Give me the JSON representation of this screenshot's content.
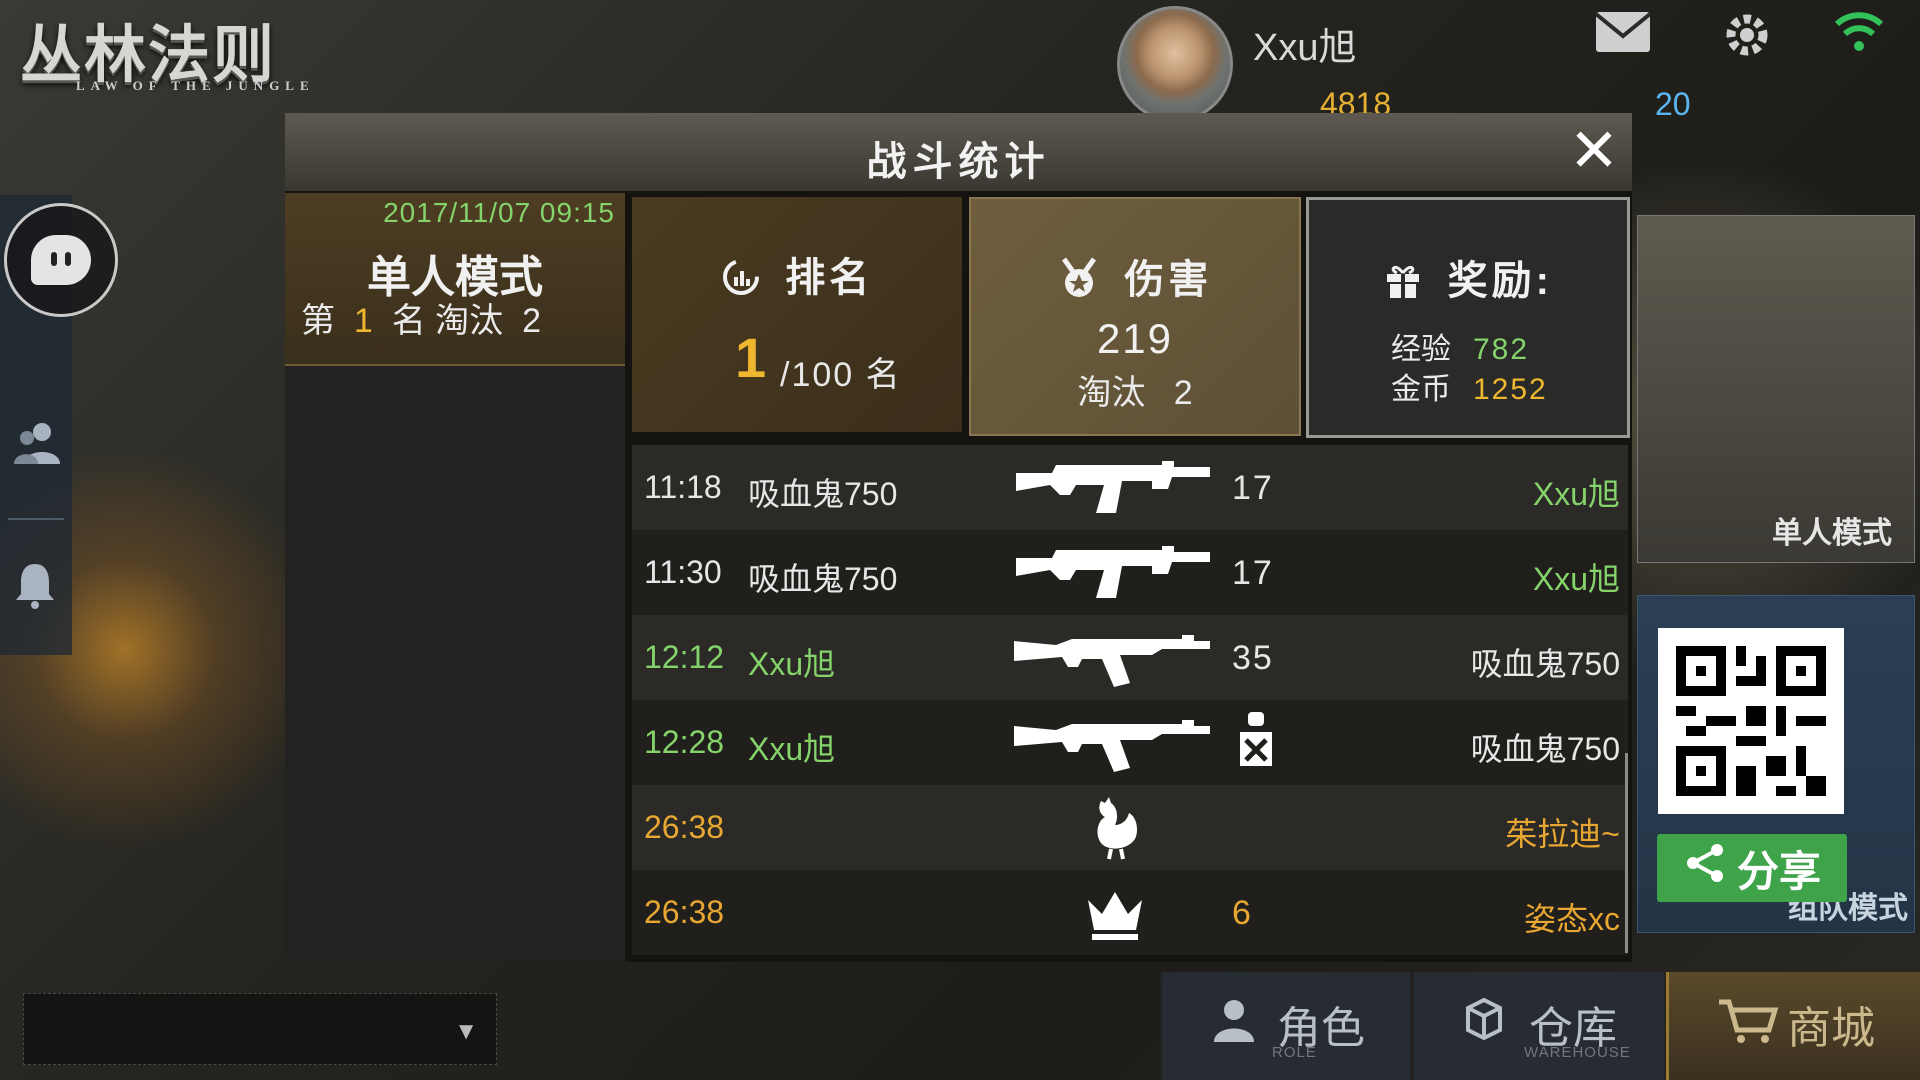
{
  "logo": {
    "title": "丛林法则",
    "subtitle": "LAW OF THE JUNGLE"
  },
  "profile": {
    "username": "Xxu旭",
    "gold": "4818",
    "diamonds": "20"
  },
  "modal": {
    "title": "战斗统计",
    "close_label": "✕",
    "summary": {
      "date": "2017/11/07 09:15",
      "mode": "单人模式",
      "rank_prefix": "第",
      "rank": "1",
      "rank_suffix": "名 淘汰",
      "kills": "2"
    },
    "rank_box": {
      "title": "排名",
      "rank": "1",
      "of": "/100 名"
    },
    "damage_box": {
      "title": "伤害",
      "damage": "219",
      "kills_label": "淘汰",
      "kills": "2"
    },
    "reward_box": {
      "title": "奖励:",
      "exp_label": "经验",
      "exp": "782",
      "coin_label": "金币",
      "coins": "1252"
    },
    "log": [
      {
        "time": "11:18",
        "actor": "吸血鬼750",
        "weapon": "rifle-icon",
        "value": "17",
        "target": "Xxu旭"
      },
      {
        "time": "11:30",
        "actor": "吸血鬼750",
        "weapon": "rifle-icon",
        "value": "17",
        "target": "Xxu旭"
      },
      {
        "time": "12:12",
        "actor": "Xxu旭",
        "weapon": "ak-icon",
        "value": "35",
        "target": "吸血鬼750"
      },
      {
        "time": "12:28",
        "actor": "Xxu旭",
        "weapon": "ak-icon",
        "value": "",
        "target": "吸血鬼750"
      },
      {
        "time": "26:38",
        "actor": "",
        "weapon": "chicken-icon",
        "value": "",
        "target": "茱拉迪~"
      },
      {
        "time": "26:38",
        "actor": "",
        "weapon": "crown-icon",
        "value": "6",
        "target": "姿态xc"
      }
    ]
  },
  "side": {
    "mode_single": "单人模式",
    "mode_team": "组队模式",
    "share_label": "分享"
  },
  "nav": {
    "role": "角色",
    "role_sub": "ROLE",
    "warehouse": "仓库",
    "warehouse_sub": "WAREHOUSE",
    "shop": "商城"
  },
  "colors": {
    "accent_gold": "#efb630",
    "accent_green": "#85d36b",
    "share_green": "#3fa34a"
  }
}
